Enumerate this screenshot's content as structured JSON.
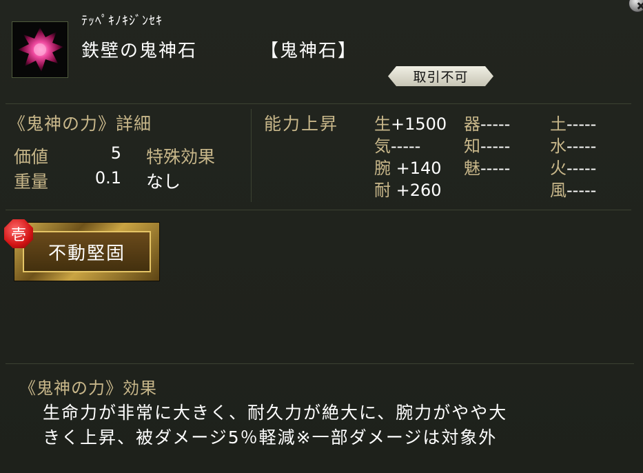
{
  "item": {
    "reading": "ﾃｯﾍﾟｷﾉｷｼﾞﾝｾｷ",
    "name": "鉄壁の鬼神石",
    "category": "【鬼神石】",
    "trade": "取引不可"
  },
  "details": {
    "title": "《鬼神の力》詳細",
    "value_label": "価値",
    "value": "5",
    "weight_label": "重量",
    "weight": "0.1",
    "special_label": "特殊効果",
    "special_value": "なし"
  },
  "ability": {
    "title": "能力上昇",
    "stats": [
      {
        "key": "生",
        "val": "+1500"
      },
      {
        "key": "器",
        "val": "-----"
      },
      {
        "key": "土",
        "val": "-----"
      },
      {
        "key": "気",
        "val": "-----"
      },
      {
        "key": "知",
        "val": "-----"
      },
      {
        "key": "水",
        "val": "-----"
      },
      {
        "key": "腕",
        "val": " +140"
      },
      {
        "key": "魅",
        "val": "-----"
      },
      {
        "key": "火",
        "val": "-----"
      },
      {
        "key": "耐",
        "val": " +260"
      },
      {
        "key": "風",
        "val": "-----"
      }
    ]
  },
  "skill": {
    "number": "壱",
    "name": "不動堅固"
  },
  "effect": {
    "title": "《鬼神の力》効果",
    "line1": "生命力が非常に大きく、耐久力が絶大に、腕力がやや大",
    "line2": "きく上昇、被ダメージ5％軽減※一部ダメージは対象外"
  },
  "icons": {
    "close": "close-icon",
    "item": "demon-stone-icon"
  },
  "colors": {
    "background": "#1f211c",
    "gold_text": "#c8b78a",
    "badge_red": "#d21414"
  }
}
